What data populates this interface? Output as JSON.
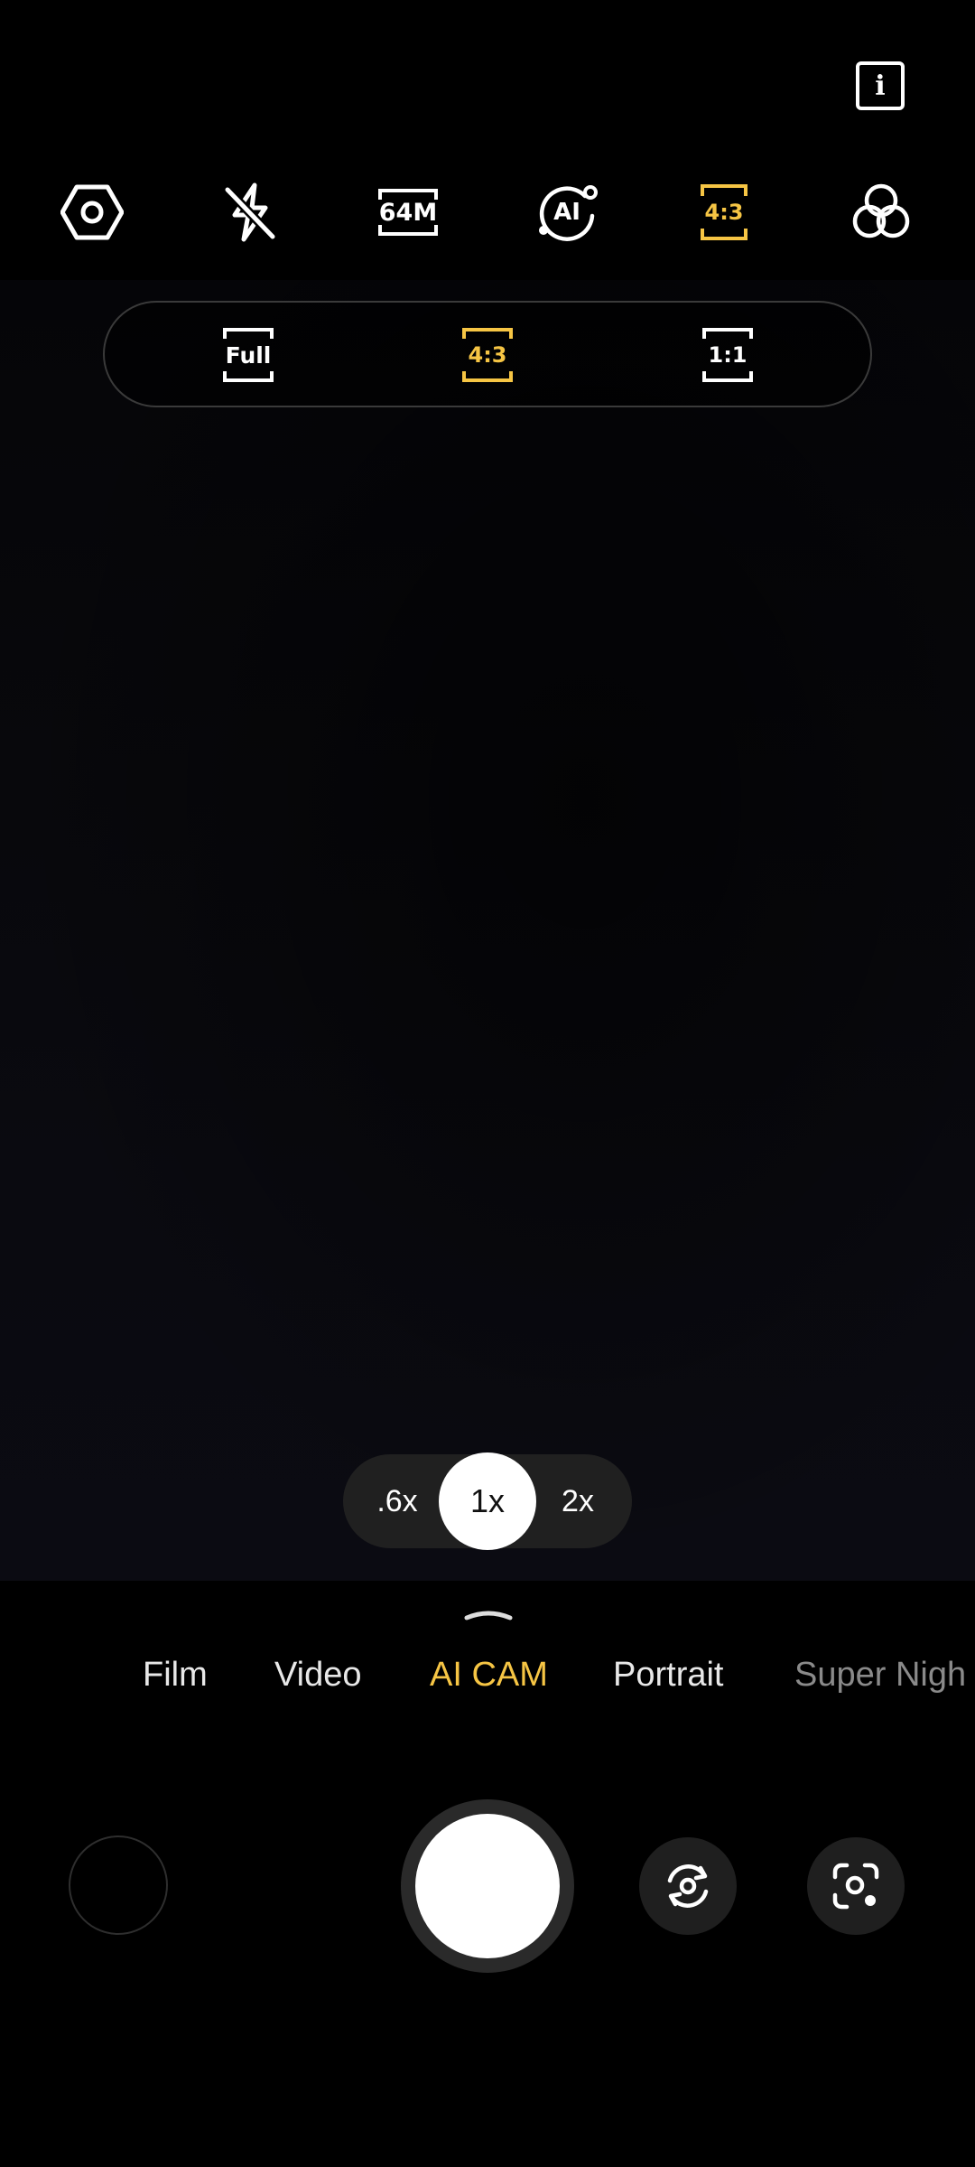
{
  "top": {
    "info_label": "i"
  },
  "toolbar": {
    "items": [
      {
        "name": "settings-icon"
      },
      {
        "name": "flash-off-icon"
      },
      {
        "name": "resolution-badge",
        "label": "64M"
      },
      {
        "name": "ai-icon",
        "label": "AI"
      },
      {
        "name": "aspect-ratio-badge",
        "label": "4:3"
      },
      {
        "name": "filter-icon"
      }
    ]
  },
  "ratio_panel": {
    "options": [
      {
        "label": "Full",
        "selected": false
      },
      {
        "label": "4:3",
        "selected": true
      },
      {
        "label": "1:1",
        "selected": false
      }
    ]
  },
  "zoom": {
    "options": [
      ".6x",
      "1x",
      "2x"
    ],
    "active": "1x"
  },
  "modes": {
    "items": [
      "Film",
      "Video",
      "AI CAM",
      "Portrait",
      "Super Nigh"
    ],
    "active": "AI CAM"
  },
  "colors": {
    "accent": "#f6c544",
    "background": "#000000",
    "pill": "#202020",
    "button": "#1f1f1f"
  },
  "controls": {
    "gallery": "gallery-thumbnail",
    "shutter": "shutter-button",
    "switch_camera": "switch-camera-icon",
    "lens": "google-lens-icon"
  }
}
